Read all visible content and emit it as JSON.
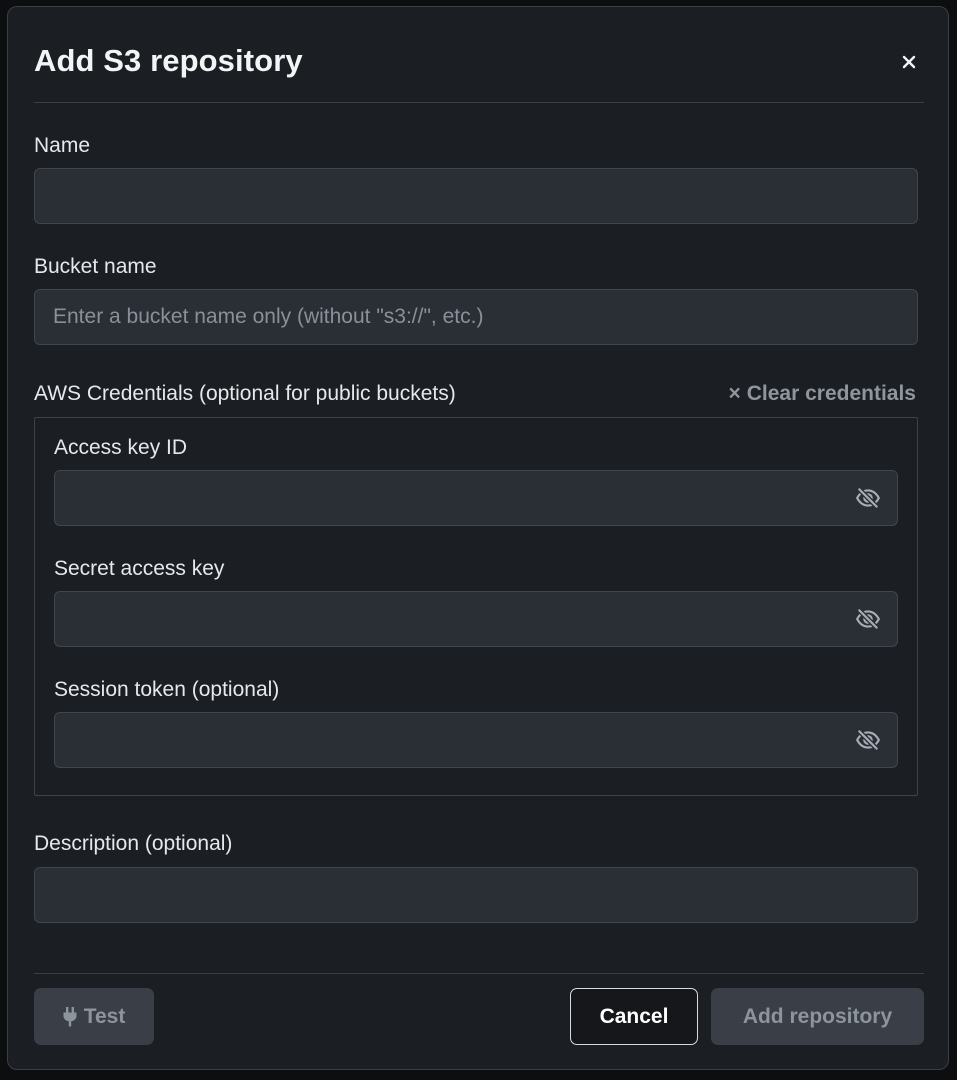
{
  "dialog": {
    "title": "Add S3 repository",
    "close_icon": "close-icon"
  },
  "fields": {
    "name": {
      "label": "Name",
      "value": "",
      "placeholder": ""
    },
    "bucket_name": {
      "label": "Bucket name",
      "value": "",
      "placeholder": "Enter a bucket name only (without \"s3://\", etc.)"
    },
    "description": {
      "label": "Description (optional)",
      "value": "",
      "placeholder": ""
    }
  },
  "credentials": {
    "section_label": "AWS Credentials (optional for public buckets)",
    "clear_label": "Clear credentials",
    "clear_icon": "close-icon",
    "access_key_id": {
      "label": "Access key ID",
      "value": "",
      "icon": "eye-slash-icon"
    },
    "secret_access_key": {
      "label": "Secret access key",
      "value": "",
      "icon": "eye-slash-icon"
    },
    "session_token": {
      "label": "Session token (optional)",
      "value": "",
      "icon": "eye-slash-icon"
    }
  },
  "footer": {
    "test_label": "Test",
    "test_icon": "plug-icon",
    "cancel_label": "Cancel",
    "add_label": "Add repository"
  },
  "colors": {
    "modal_bg": "#1b1e22",
    "input_bg": "#2a2e35",
    "disabled_button_bg": "#3a3f47",
    "disabled_text": "#8e949c"
  }
}
